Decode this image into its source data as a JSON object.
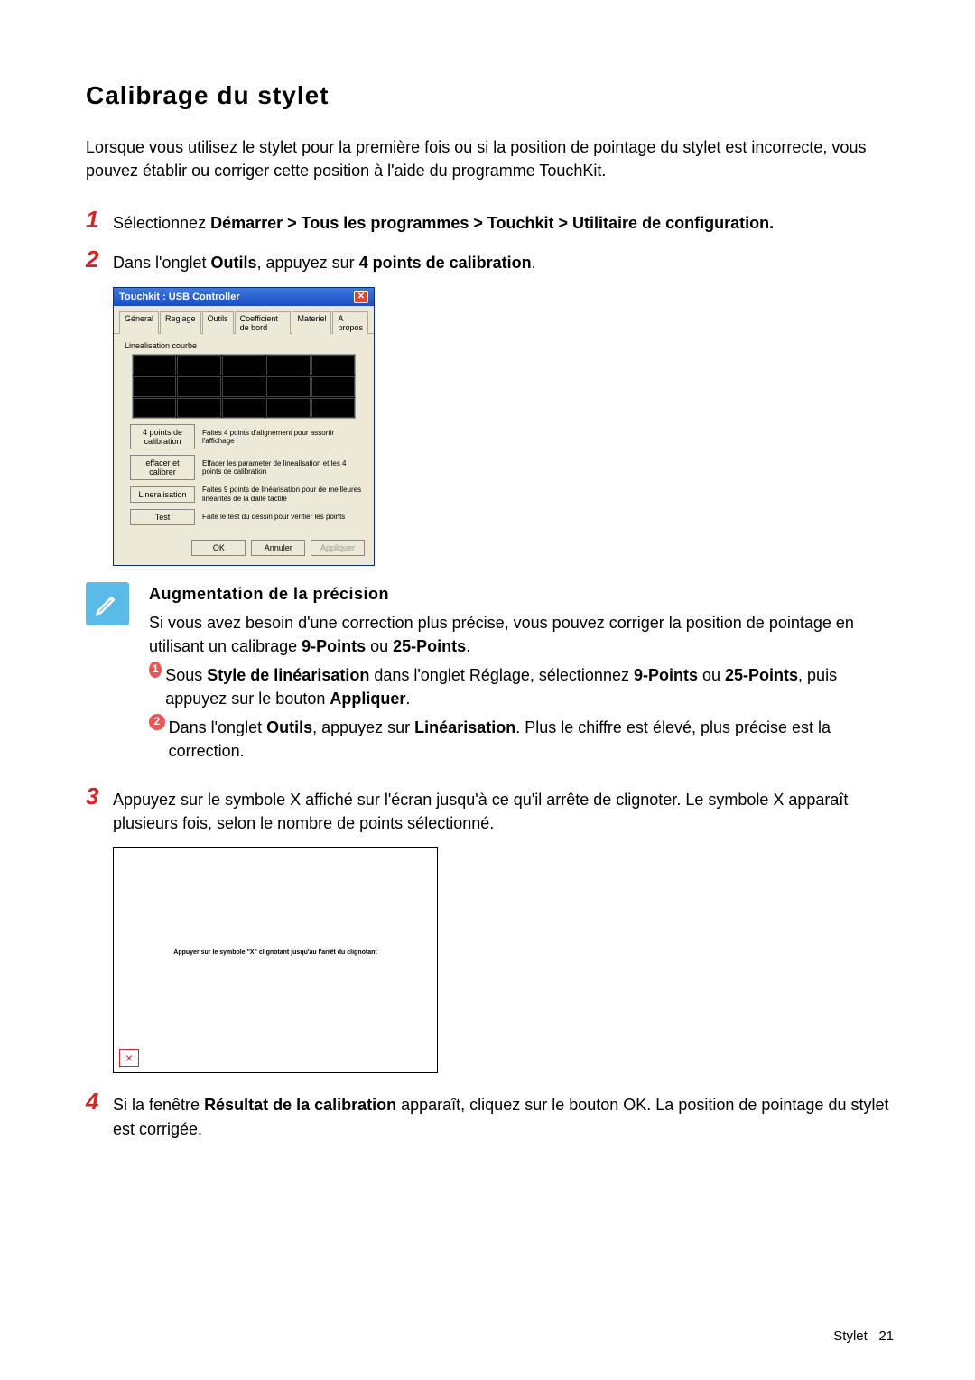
{
  "title": "Calibrage du stylet",
  "intro": "Lorsque vous utilisez le stylet pour la première fois ou si la position de pointage du stylet est incorrecte, vous pouvez établir ou corriger cette position à l'aide du programme TouchKit.",
  "steps": {
    "s1": {
      "num": "1",
      "pre": "Sélectionnez ",
      "bold": "Démarrer > Tous les programmes > Touchkit > Utilitaire de configuration.",
      "post": ""
    },
    "s2": {
      "num": "2",
      "pre": "Dans l'onglet ",
      "bold1": "Outils",
      "mid": ", appuyez sur ",
      "bold2": "4 points de calibration",
      "post": "."
    },
    "s3": {
      "num": "3",
      "text": "Appuyez sur le symbole X affiché sur l'écran jusqu'à ce qu'il arrête de clignoter. Le symbole X apparaît plusieurs fois, selon le nombre de points sélectionné."
    },
    "s4": {
      "num": "4",
      "pre": "Si la fenêtre ",
      "bold": "Résultat de la calibration",
      "post": " apparaît, cliquez sur le bouton OK. La position de pointage du stylet est corrigée."
    }
  },
  "dialog": {
    "title": "Touchkit : USB Controller",
    "tabs": [
      "Géneral",
      "Reglage",
      "Outils",
      "Coefficient de bord",
      "Materiel",
      "A propos"
    ],
    "activeTab": 2,
    "group": "Linealisation courbe",
    "buttons": {
      "b1": {
        "label": "4 points de calibration",
        "desc": "Faites 4 points d'alignement pour assortir l'affichage"
      },
      "b2": {
        "label": "effacer et calibrer",
        "desc": "Effacer les parameter de linealisation et les 4 points de calibration"
      },
      "b3": {
        "label": "Lineralisation",
        "desc": "Faites 9 points de linéarisation pour de meilleures linéarités de la dalle tactile"
      },
      "b4": {
        "label": "Test",
        "desc": "Faite le test du dessin  pour verifier les points"
      }
    },
    "actions": {
      "ok": "OK",
      "cancel": "Annuler",
      "apply": "Appliquer"
    }
  },
  "note": {
    "title": "Augmentation de la précision",
    "body": "Si vous avez besoin d'une correction plus précise, vous pouvez corriger la position de pointage en utilisant un calibrage ",
    "body_b1": "9-Points",
    "body_mid": " ou ",
    "body_b2": "25-Points",
    "body_end": ".",
    "i1": {
      "num": "1",
      "pre": "Sous ",
      "b1": "Style de linéarisation",
      "mid": " dans l'onglet Réglage, sélectionnez ",
      "b2": "9-Points",
      "mid2": " ou ",
      "b3": "25-Points",
      "mid3": ", puis appuyez sur le bouton ",
      "b4": "Appliquer",
      "end": "."
    },
    "i2": {
      "num": "2",
      "pre": "Dans l'onglet ",
      "b1": "Outils",
      "mid": ", appuyez sur ",
      "b2": "Linéarisation",
      "end": ". Plus le chiffre est élevé, plus précise est la correction."
    }
  },
  "calib": {
    "text": "Appuyer sur le symbole \"X\" clignotant  jusqu'au l'arrêt du clignotant",
    "mark": "×"
  },
  "footer": {
    "section": "Stylet",
    "page": "21"
  }
}
